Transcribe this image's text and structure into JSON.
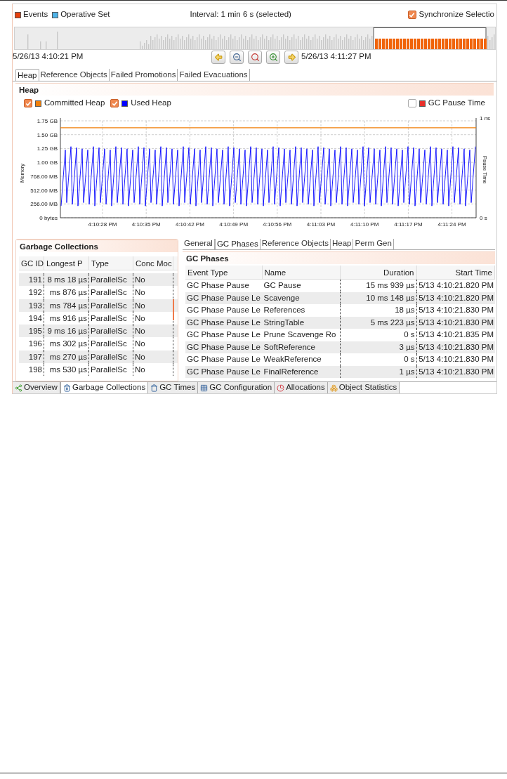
{
  "timeline": {
    "legend": [
      {
        "label": "Events",
        "color": "#e8400c"
      },
      {
        "label": "Operative Set",
        "color": "#4fb3e8"
      }
    ],
    "interval": "Interval: 1 min 6 s (selected)",
    "synchronize": {
      "label": "Synchronize Selectio",
      "checked": true
    },
    "start": "5/26/13 4:10:21 PM",
    "end": "5/26/13 4:11:27 PM"
  },
  "tabs": [
    {
      "label": "Heap",
      "selected": true
    },
    {
      "label": "Reference Objects",
      "selected": false
    },
    {
      "label": "Failed Promotions",
      "selected": false
    },
    {
      "label": "Failed Evacuations",
      "selected": false
    }
  ],
  "heap": {
    "title": "Heap",
    "series": [
      {
        "label": "Committed Heap",
        "color": "#f07f0a",
        "checked": true
      },
      {
        "label": "Used Heap",
        "color": "#0000ff",
        "checked": true
      },
      {
        "label": "GC Pause Time",
        "color": "#e8302a",
        "checked": false
      }
    ],
    "y_axis_title": "Memory",
    "y_ticks": [
      "1.75 GB",
      "1.50 GB",
      "1.25 GB",
      "1.00 GB",
      "768.00 MB",
      "512.00 MB",
      "256.00 MB",
      "0 bytes"
    ],
    "x_ticks": [
      "4:10:28 PM",
      "4:10:35 PM",
      "4:10:42 PM",
      "4:10:49 PM",
      "4:10:56 PM",
      "4:11:03 PM",
      "4:11:10 PM",
      "4:11:17 PM",
      "4:11:24 PM"
    ],
    "right_axis_title": "Pause Time",
    "right_ticks": [
      "1 ns",
      "0 s"
    ]
  },
  "gc_panel": {
    "title": "Garbage Collections",
    "columns": [
      "GC ID",
      "Longest P",
      "Type",
      "Conc Moc"
    ],
    "rows": [
      [
        "191",
        "8 ms 18 µs",
        "ParallelSc",
        "No"
      ],
      [
        "192",
        "ms 876 µs",
        "ParallelSc",
        "No"
      ],
      [
        "193",
        "ms 784 µs",
        "ParallelSc",
        "No"
      ],
      [
        "194",
        "ms 916 µs",
        "ParallelSc",
        "No"
      ],
      [
        "195",
        "9 ms 16 µs",
        "ParallelSc",
        "No"
      ],
      [
        "196",
        "ms 302 µs",
        "ParallelSc",
        "No"
      ],
      [
        "197",
        "ms 270 µs",
        "ParallelSc",
        "No"
      ],
      [
        "198",
        "ms 530 µs",
        "ParallelSc",
        "No"
      ]
    ]
  },
  "detail_tabs": [
    {
      "label": "General",
      "selected": false
    },
    {
      "label": "GC Phases",
      "selected": true
    },
    {
      "label": "Reference Objects",
      "selected": false
    },
    {
      "label": "Heap",
      "selected": false
    },
    {
      "label": "Perm Gen",
      "selected": false
    }
  ],
  "phases": {
    "title": "GC Phases",
    "columns": [
      "Event Type",
      "Name",
      "Duration",
      "Start Time"
    ],
    "rows": [
      [
        "GC Phase Pause",
        "GC Pause",
        "15 ms 939 µs",
        "5/13 4:10:21.820 PM"
      ],
      [
        "GC Phase Pause Le",
        "Scavenge",
        "10 ms 148 µs",
        "5/13 4:10:21.820 PM"
      ],
      [
        "GC Phase Pause Le",
        "References",
        "18 µs",
        "5/13 4:10:21.830 PM"
      ],
      [
        "GC Phase Pause Le",
        "StringTable",
        "5 ms 223 µs",
        "5/13 4:10:21.830 PM"
      ],
      [
        "GC Phase Pause Le",
        "Prune Scavenge Ro",
        "0 s",
        "5/13 4:10:21.835 PM"
      ],
      [
        "GC Phase Pause Le",
        "SoftReference",
        "3 µs",
        "5/13 4:10:21.830 PM"
      ],
      [
        "GC Phase Pause Le",
        "WeakReference",
        "0 s",
        "5/13 4:10:21.830 PM"
      ],
      [
        "GC Phase Pause Le",
        "FinalReference",
        "1 µs",
        "5/13 4:10:21.830 PM"
      ]
    ]
  },
  "bottom_tabs": [
    {
      "label": "Overview",
      "selected": false
    },
    {
      "label": "Garbage Collections",
      "selected": true
    },
    {
      "label": "GC Times",
      "selected": false
    },
    {
      "label": "GC Configuration",
      "selected": false
    },
    {
      "label": "Allocations",
      "selected": false
    },
    {
      "label": "Object Statistics",
      "selected": false
    }
  ]
}
